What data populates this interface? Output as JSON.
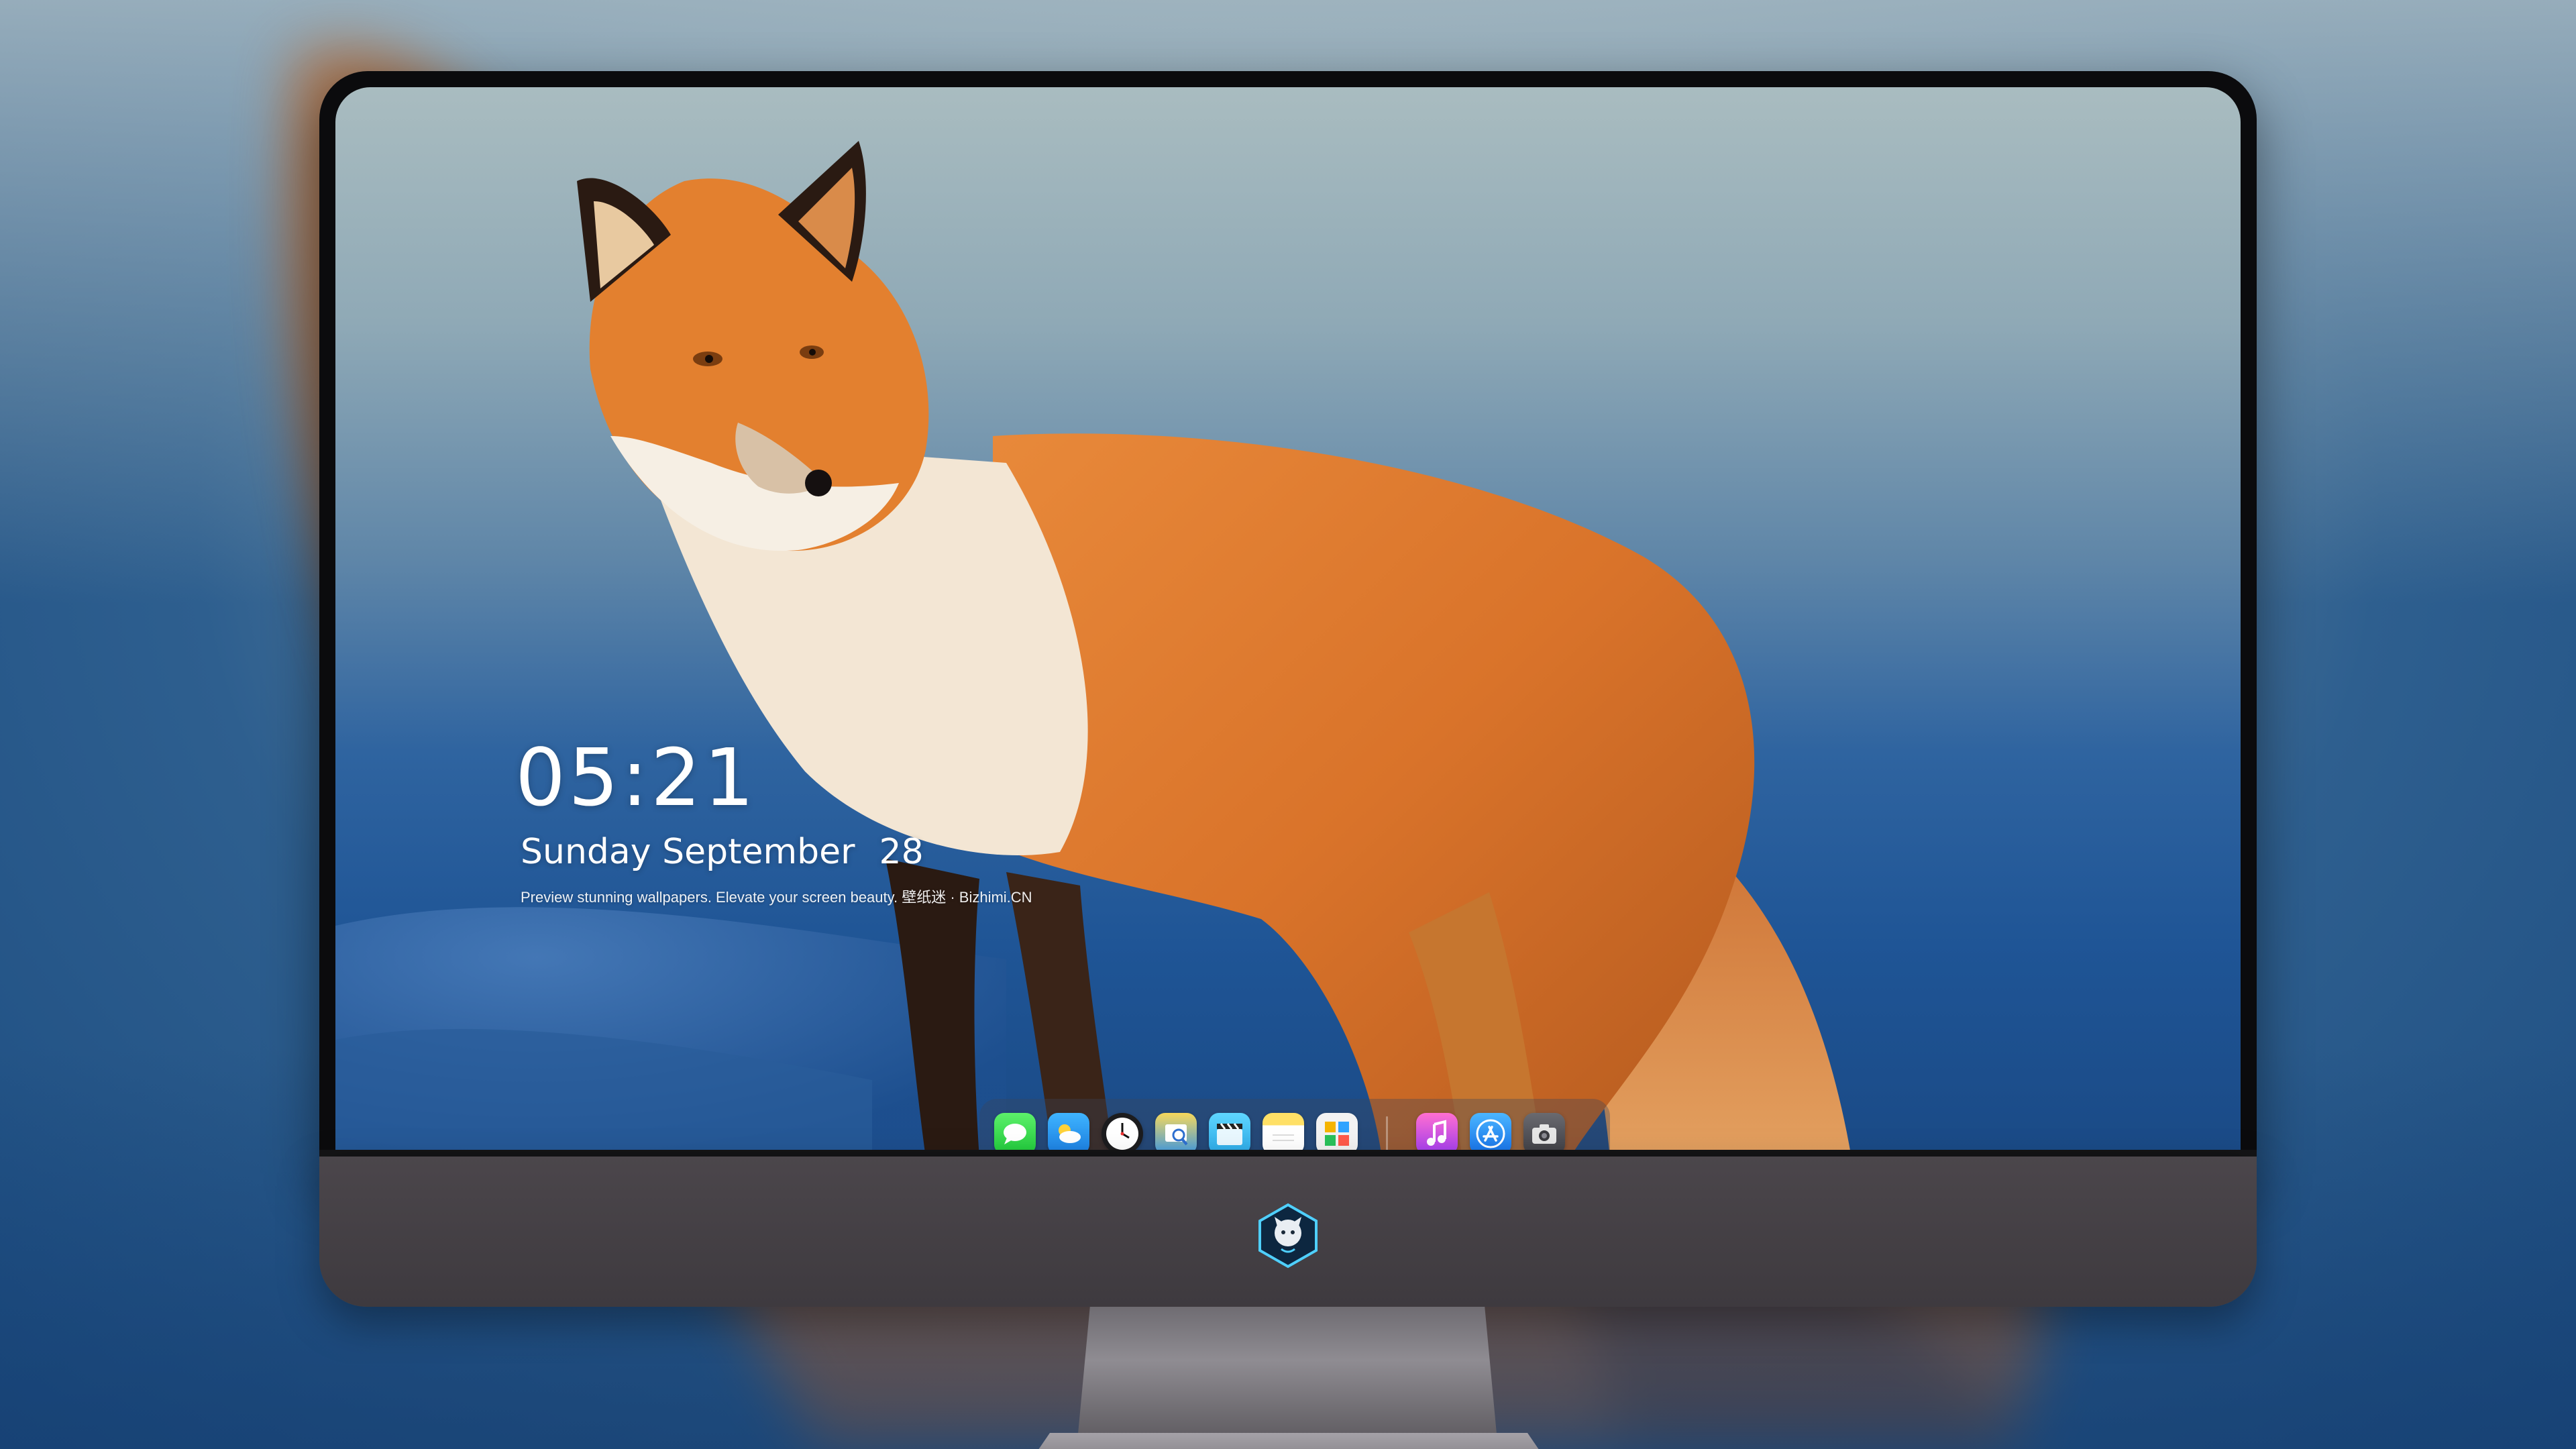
{
  "lock_screen": {
    "time": "05:21",
    "day_month": "Sunday September",
    "day_number": "28",
    "tagline": "Preview stunning wallpapers. Elevate your screen beauty. 壁纸迷 · Bizhimi.CN"
  },
  "dock": {
    "apps": [
      {
        "name": "Messages",
        "icon": "messages-icon"
      },
      {
        "name": "Weather",
        "icon": "weather-icon"
      },
      {
        "name": "Clock",
        "icon": "clock-icon"
      },
      {
        "name": "Preview",
        "icon": "preview-icon"
      },
      {
        "name": "Claquette",
        "icon": "clapperboard-icon"
      },
      {
        "name": "Notes",
        "icon": "notes-icon"
      },
      {
        "name": "Photo Booth",
        "icon": "photo-grid-icon"
      },
      {
        "name": "Music",
        "icon": "music-note-icon"
      },
      {
        "name": "App Store",
        "icon": "app-store-icon"
      },
      {
        "name": "Screenshot",
        "icon": "camera-icon"
      }
    ]
  },
  "colors": {
    "fox_orange": "#d9732a",
    "sky": "#a9bcc0",
    "sea": "#1f5596",
    "bezel": "#0b0b0d",
    "chin": "#443f44"
  }
}
